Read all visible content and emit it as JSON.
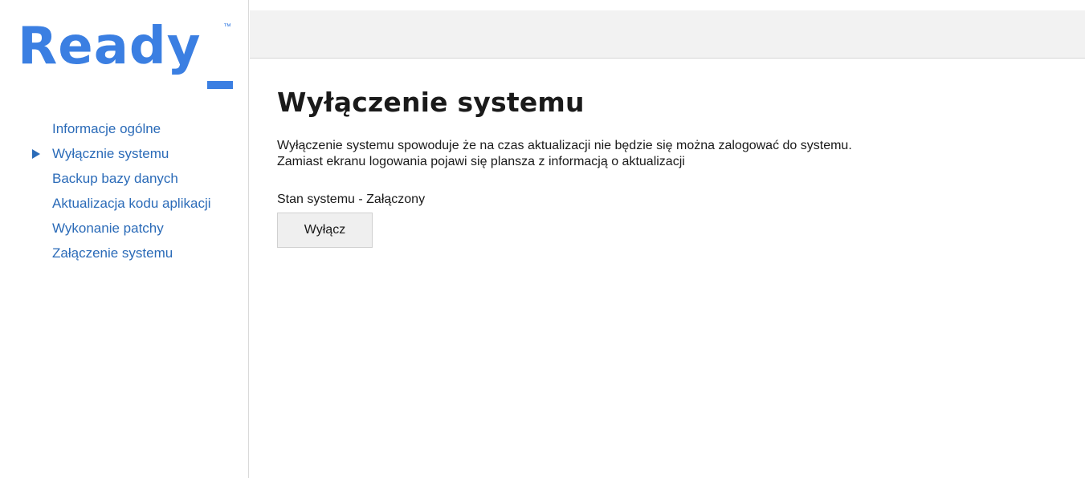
{
  "logo": {
    "text": "Ready",
    "trademark": "™",
    "color": "#3b7fe2"
  },
  "sidebar": {
    "items": [
      {
        "label": "Informacje ogólne",
        "active": false
      },
      {
        "label": "Wyłącznie systemu",
        "active": true
      },
      {
        "label": "Backup bazy danych",
        "active": false
      },
      {
        "label": "Aktualizacja kodu aplikacji",
        "active": false
      },
      {
        "label": "Wykonanie patchy",
        "active": false
      },
      {
        "label": "Załączenie systemu",
        "active": false
      }
    ],
    "link_color": "#2b6bb8"
  },
  "main": {
    "title": "Wyłączenie systemu",
    "description_line1": "Wyłączenie systemu spowoduje że na czas aktualizacji nie będzie się można zalogować do systemu.",
    "description_line2": "Zamiast ekranu logowania pojawi się plansza z informacją o aktualizacji",
    "status": "Stan systemu - Załączony",
    "button_label": "Wyłącz"
  }
}
